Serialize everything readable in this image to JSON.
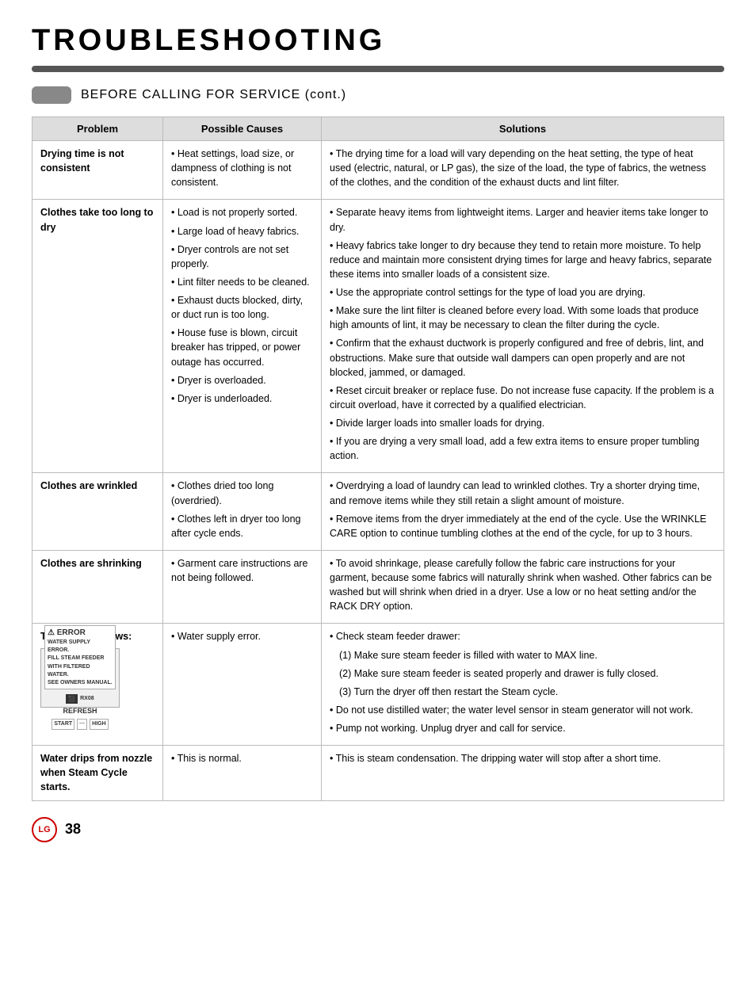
{
  "page": {
    "title": "TROUBLESHOOTING",
    "footer_page": "38"
  },
  "section": {
    "label": "BEFORE CALLING FOR SERVICE",
    "subtitle": "(cont.)"
  },
  "table": {
    "headers": [
      "Problem",
      "Possible Causes",
      "Solutions"
    ],
    "rows": [
      {
        "problem": "Drying time is not consistent",
        "causes": [
          "Heat settings, load size, or dampness of clothing is not consistent."
        ],
        "solutions": [
          "The drying time for a load will vary depending on the heat setting, the type of heat used (electric, natural, or LP gas), the size of the load, the type of fabrics, the wetness of the clothes, and the condition of the exhaust ducts and lint filter."
        ]
      },
      {
        "problem": "Clothes take too long to dry",
        "causes": [
          "Load is not properly sorted.",
          "Large load of heavy fabrics.",
          "Dryer controls are not set properly.",
          "Lint filter needs to be cleaned.",
          "Exhaust ducts blocked, dirty, or duct run is too long.",
          "House fuse is blown, circuit breaker has tripped, or power outage has occurred.",
          "Dryer is overloaded.",
          "Dryer is underloaded."
        ],
        "solutions": [
          "Separate heavy items from lightweight items. Larger and heavier items take longer to dry.",
          "Heavy fabrics take longer to dry because they tend to retain more moisture. To help reduce and maintain more consistent drying times for large and heavy fabrics, separate these items into smaller loads of a consistent size.",
          "Use the appropriate control settings for the type of load you are drying.",
          "Make sure the lint filter is cleaned before every load. With some loads that produce high amounts of lint, it may be necessary to clean the filter during the cycle.",
          "Confirm that the exhaust ductwork is properly configured and free of debris, lint, and obstructions. Make sure that outside wall dampers can open properly and are not blocked, jammed, or damaged.",
          "Reset circuit breaker or replace fuse. Do not increase fuse capacity. If the problem is a circuit overload, have it corrected by a qualified electrician.",
          "Divide larger loads into smaller loads for drying.",
          "If you are drying a very small load, add a few extra items to ensure proper tumbling action."
        ]
      },
      {
        "problem": "Clothes are wrinkled",
        "causes": [
          "Clothes dried too long (overdried).",
          "Clothes left in dryer too long after cycle ends."
        ],
        "solutions": [
          "Overdrying a load of laundry can lead to wrinkled clothes. Try a shorter drying time, and remove items while they still retain a slight amount of moisture.",
          "Remove items from the dryer immediately at the end of the cycle. Use the WRINKLE CARE option to continue tumbling clothes at the end of the cycle, for up to 3 hours."
        ]
      },
      {
        "problem": "Clothes are shrinking",
        "causes": [
          "Garment care instructions are not being followed."
        ],
        "solutions": [
          "To avoid shrinkage, please carefully follow the fabric care instructions for your garment, because some fabrics will naturally shrink when washed. Other fabrics can be washed but will shrink when dried in a dryer. Use a low or no heat setting and/or the RACK DRY option."
        ]
      },
      {
        "problem": "The display shows:",
        "causes": [
          "Water supply error."
        ],
        "solutions": [
          "Check steam feeder drawer:",
          "(1) Make sure steam feeder is filled with water to MAX line.",
          "(2) Make sure steam feeder is seated properly and drawer is fully closed.",
          "(3) Turn the dryer off then restart the Steam cycle.",
          "Do not use distilled water; the water level sensor in steam generator will not work.",
          "Pump not working. Unplug dryer and call for service."
        ],
        "has_display_image": true
      },
      {
        "problem": "Water drips from nozzle when Steam Cycle starts.",
        "causes": [
          "This is normal."
        ],
        "solutions": [
          "This is steam condensation. The dripping water will stop after a short time."
        ]
      }
    ]
  }
}
